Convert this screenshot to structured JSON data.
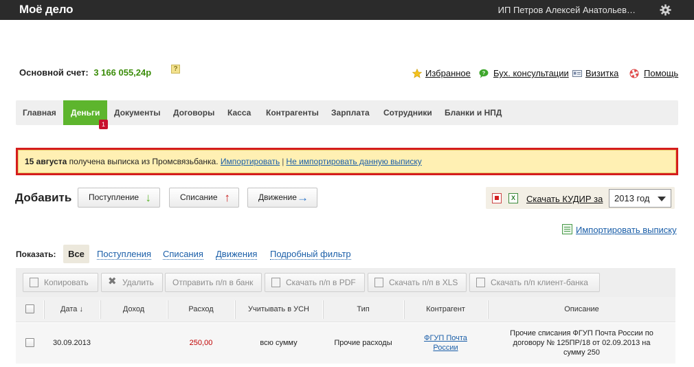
{
  "app": {
    "logo": "Моё дело",
    "user": "ИП Петров Алексей Анатольев…"
  },
  "account": {
    "label": "Основной счет:",
    "amount": "3 166 055,24р",
    "help": "?"
  },
  "toplinks": {
    "favorites": "Избранное",
    "consult": "Бух. консультации",
    "card": "Визитка",
    "help": "Помощь"
  },
  "nav": {
    "items": [
      "Главная",
      "Деньги",
      "Документы",
      "Договоры",
      "Касса",
      "Контрагенты",
      "Зарплата",
      "Сотрудники",
      "Бланки и НПД"
    ],
    "active_index": 1,
    "badge": "1"
  },
  "notice": {
    "date": "15 августа",
    "text": " получена выписка из Промсвязьбанка. ",
    "import": "Импортировать",
    "separator": "|",
    "skip": "Не импортировать данную выписку"
  },
  "add": {
    "label": "Добавить",
    "income": "Поступление",
    "expense": "Списание",
    "transfer": "Движение"
  },
  "kudir": {
    "link": "Скачать КУДИР за",
    "year": "2013 год",
    "xls_icon": "X"
  },
  "import_statement": "Импортировать выписку",
  "filter": {
    "label": "Показать:",
    "all": "Все",
    "income": "Поступления",
    "expense": "Списания",
    "moves": "Движения",
    "detailed": "Подробный фильтр"
  },
  "toolbar": {
    "copy": "Копировать",
    "delete": "Удалить",
    "send": "Отправить п/п в банк",
    "pdf": "Скачать п/п в PDF",
    "xls": "Скачать п/п в XLS",
    "client": "Скачать п/п клиент-банка"
  },
  "table": {
    "headers": [
      "Дата ↓",
      "Доход",
      "Расход",
      "Учитывать в УСН",
      "Тип",
      "Контрагент",
      "Описание"
    ],
    "rows": [
      {
        "date": "30.09.2013",
        "income": "",
        "expense": "250,00",
        "usn": "всю сумму",
        "type": "Прочие расходы",
        "counterparty_1": "ФГУП Почта",
        "counterparty_2": "России",
        "desc_1": "Прочие списания ФГУП Почта России по",
        "desc_2": "договору № 125ПР/18 от 02.09.2013 на",
        "desc_3": "сумму 250"
      }
    ]
  },
  "colors": {
    "accent_green": "#5db52d",
    "alert_red": "#d51d1d",
    "link_blue": "#1a5ea8",
    "amount_green": "#3b8d0a"
  }
}
